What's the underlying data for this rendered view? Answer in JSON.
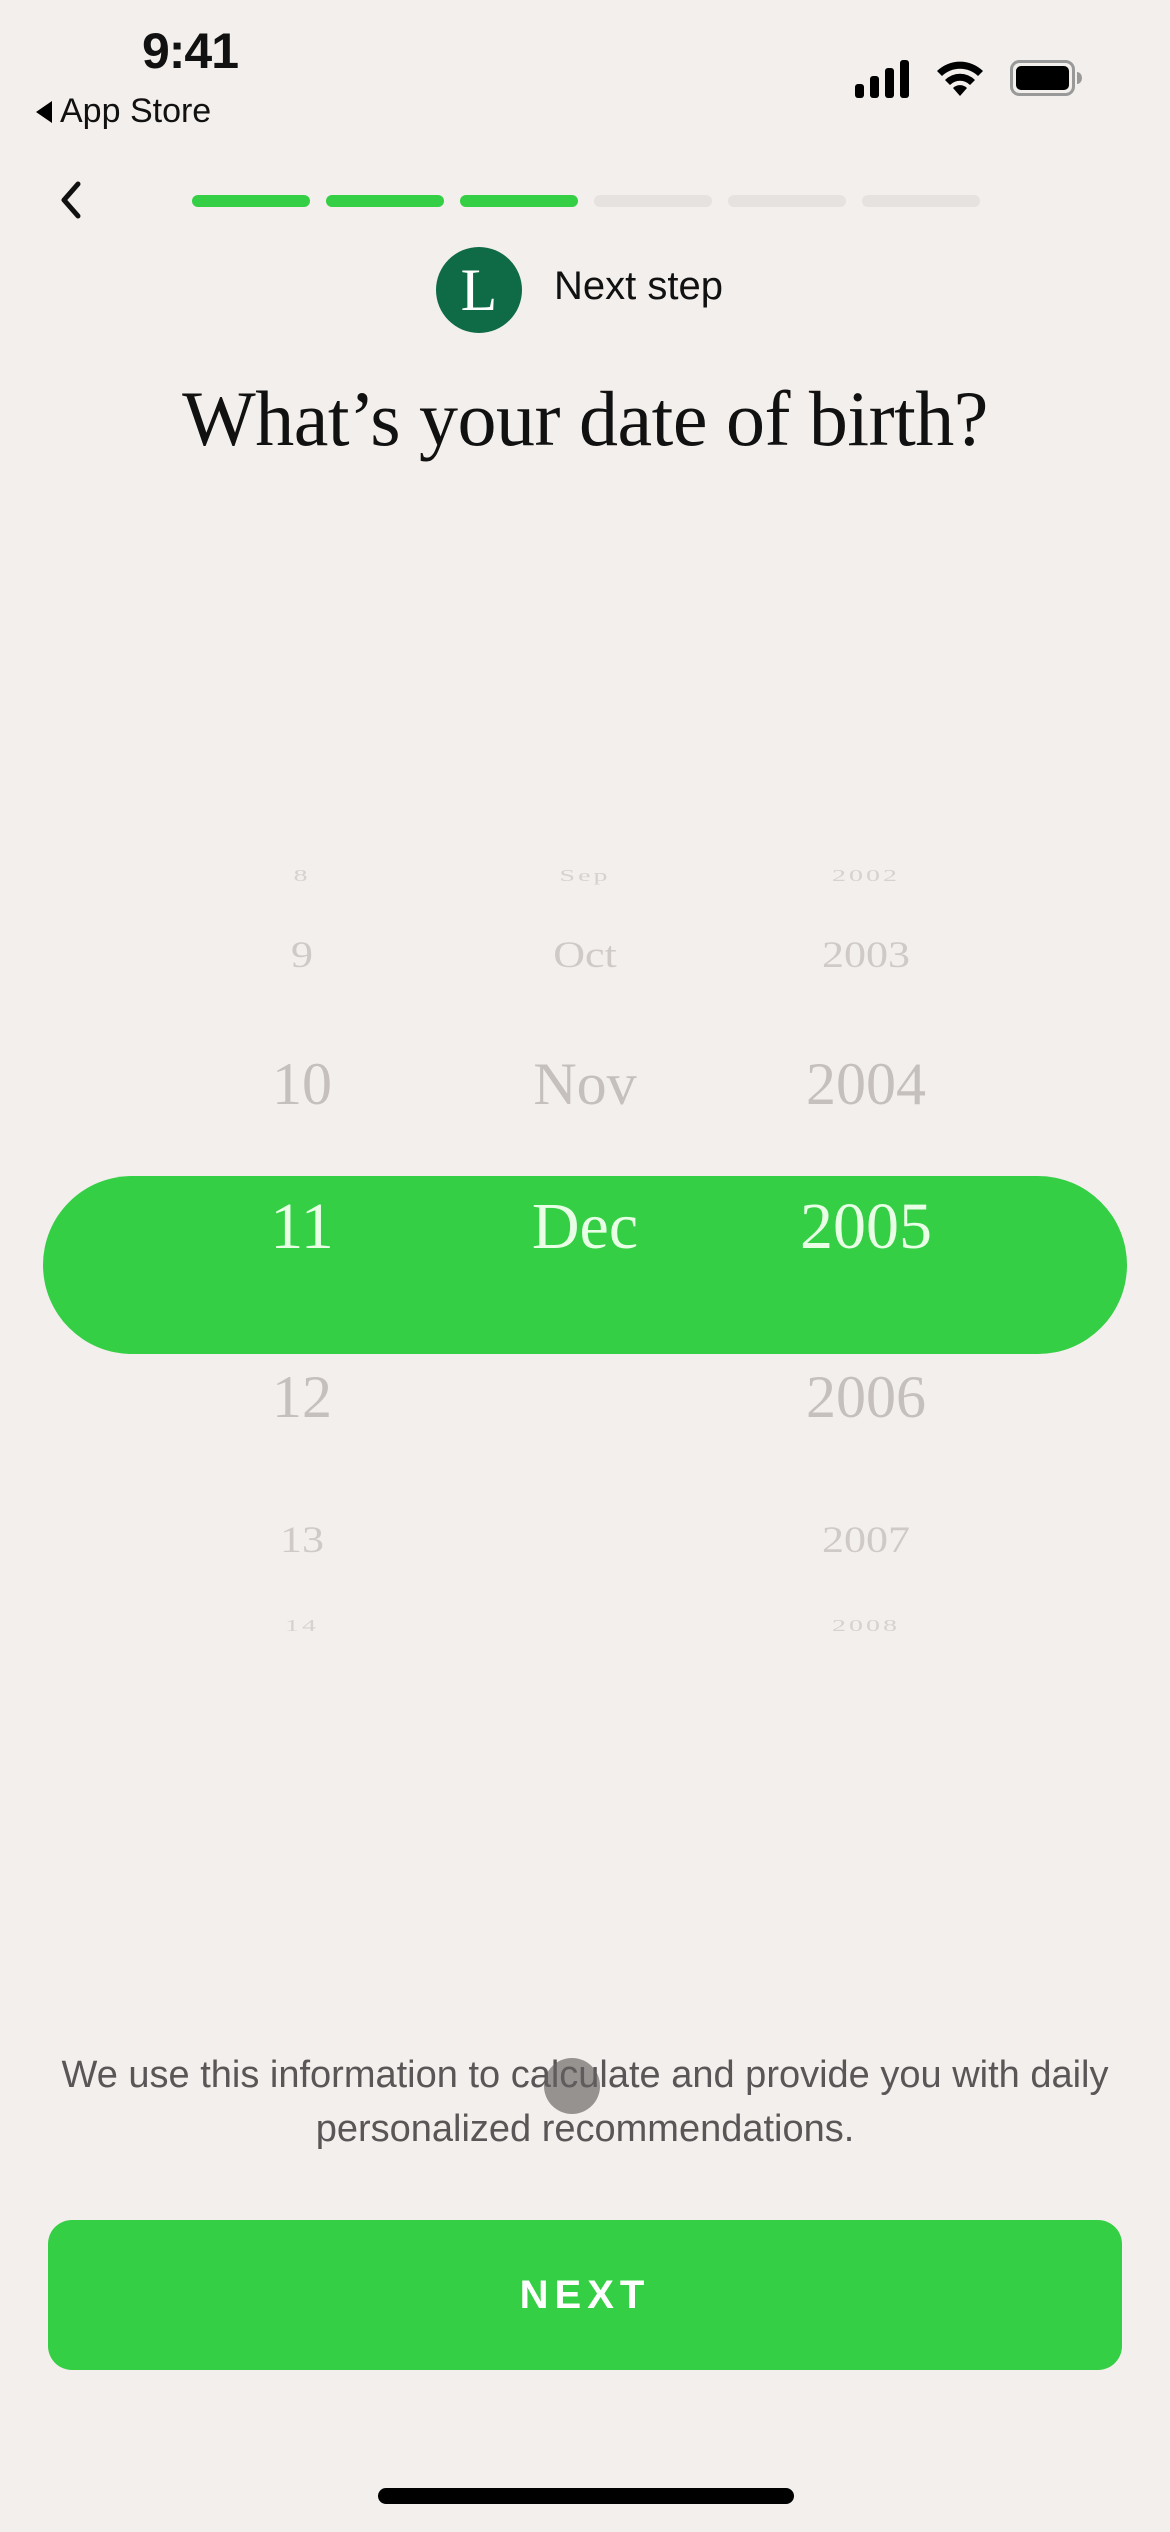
{
  "status_bar": {
    "time": "9:41",
    "back_app_label": "App Store",
    "icons": [
      "cellular-signal-icon",
      "wifi-icon",
      "battery-icon"
    ]
  },
  "nav": {
    "back_icon": "chevron-left-icon",
    "progress": {
      "total_steps": 6,
      "completed_steps": 3
    },
    "accent_color": "#34cf45"
  },
  "step_badge": {
    "avatar_letter": "L",
    "avatar_color": "#0e6b46",
    "label": "Next step"
  },
  "title": "What’s your date of birth?",
  "date_picker": {
    "day": {
      "items": [
        "8",
        "9",
        "10",
        "11",
        "12",
        "13",
        "14"
      ],
      "selected": "11"
    },
    "month": {
      "items": [
        "Sep",
        "Oct",
        "Nov",
        "Dec"
      ],
      "selected": "Dec"
    },
    "year": {
      "items": [
        "2002",
        "2003",
        "2004",
        "2005",
        "2006",
        "2007",
        "2008"
      ],
      "selected": "2005"
    }
  },
  "description": "We use this information to calculate and provide you with daily personalized recommendations.",
  "next_button": {
    "label": "NEXT"
  }
}
